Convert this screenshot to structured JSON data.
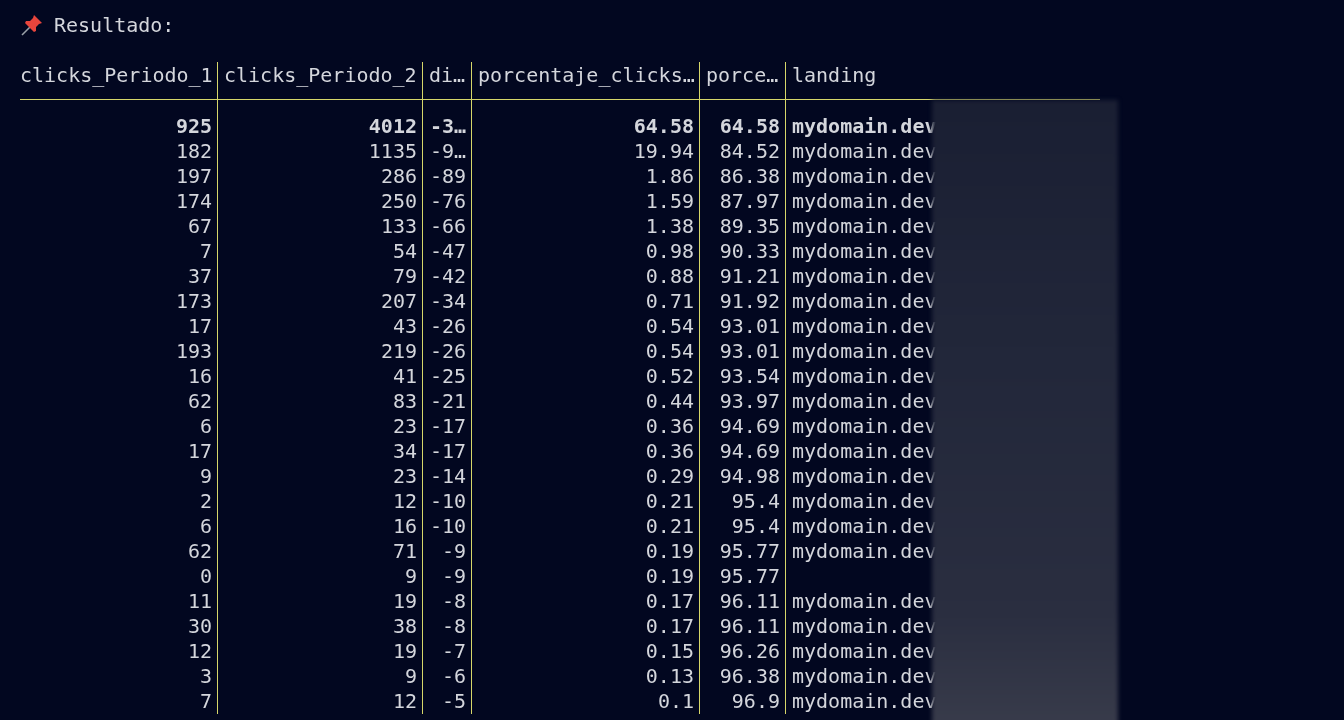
{
  "heading": {
    "text": "Resultado:"
  },
  "table": {
    "columns": [
      "clicks_Periodo_1",
      "clicks_Periodo_2",
      "di…",
      "porcentaje_clicks…",
      "porce…",
      "landing"
    ],
    "rows": [
      {
        "bold": true,
        "cells": [
          "925",
          "4012",
          "-3…",
          "64.58",
          "64.58",
          "mydomain.dev"
        ]
      },
      {
        "bold": false,
        "cells": [
          "182",
          "1135",
          "-9…",
          "19.94",
          "84.52",
          "mydomain.dev"
        ]
      },
      {
        "bold": false,
        "cells": [
          "197",
          "286",
          "-89",
          "1.86",
          "86.38",
          "mydomain.dev"
        ]
      },
      {
        "bold": false,
        "cells": [
          "174",
          "250",
          "-76",
          "1.59",
          "87.97",
          "mydomain.dev"
        ]
      },
      {
        "bold": false,
        "cells": [
          "67",
          "133",
          "-66",
          "1.38",
          "89.35",
          "mydomain.dev"
        ]
      },
      {
        "bold": false,
        "cells": [
          "7",
          "54",
          "-47",
          "0.98",
          "90.33",
          "mydomain.dev"
        ]
      },
      {
        "bold": false,
        "cells": [
          "37",
          "79",
          "-42",
          "0.88",
          "91.21",
          "mydomain.dev"
        ]
      },
      {
        "bold": false,
        "cells": [
          "173",
          "207",
          "-34",
          "0.71",
          "91.92",
          "mydomain.dev"
        ]
      },
      {
        "bold": false,
        "cells": [
          "17",
          "43",
          "-26",
          "0.54",
          "93.01",
          "mydomain.dev"
        ]
      },
      {
        "bold": false,
        "cells": [
          "193",
          "219",
          "-26",
          "0.54",
          "93.01",
          "mydomain.dev"
        ]
      },
      {
        "bold": false,
        "cells": [
          "16",
          "41",
          "-25",
          "0.52",
          "93.54",
          "mydomain.dev"
        ]
      },
      {
        "bold": false,
        "cells": [
          "62",
          "83",
          "-21",
          "0.44",
          "93.97",
          "mydomain.dev"
        ]
      },
      {
        "bold": false,
        "cells": [
          "6",
          "23",
          "-17",
          "0.36",
          "94.69",
          "mydomain.dev"
        ]
      },
      {
        "bold": false,
        "cells": [
          "17",
          "34",
          "-17",
          "0.36",
          "94.69",
          "mydomain.dev"
        ]
      },
      {
        "bold": false,
        "cells": [
          "9",
          "23",
          "-14",
          "0.29",
          "94.98",
          "mydomain.dev"
        ]
      },
      {
        "bold": false,
        "cells": [
          "2",
          "12",
          "-10",
          "0.21",
          "95.4",
          "mydomain.dev"
        ]
      },
      {
        "bold": false,
        "cells": [
          "6",
          "16",
          "-10",
          "0.21",
          "95.4",
          "mydomain.dev"
        ]
      },
      {
        "bold": false,
        "cells": [
          "62",
          "71",
          "-9",
          "0.19",
          "95.77",
          "mydomain.dev"
        ]
      },
      {
        "bold": false,
        "cells": [
          "0",
          "9",
          "-9",
          "0.19",
          "95.77"
        ]
      },
      {
        "bold": false,
        "cells": [
          "11",
          "19",
          "-8",
          "0.17",
          "96.11",
          "mydomain.dev"
        ]
      },
      {
        "bold": false,
        "cells": [
          "30",
          "38",
          "-8",
          "0.17",
          "96.11",
          "mydomain.dev"
        ]
      },
      {
        "bold": false,
        "cells": [
          "12",
          "19",
          "-7",
          "0.15",
          "96.26",
          "mydomain.dev"
        ]
      },
      {
        "bold": false,
        "cells": [
          "3",
          "9",
          "-6",
          "0.13",
          "96.38",
          "mydomain.dev"
        ]
      },
      {
        "bold": false,
        "cells": [
          "7",
          "12",
          "-5",
          "0.1",
          "96.9",
          "mydomain.dev"
        ]
      }
    ]
  }
}
